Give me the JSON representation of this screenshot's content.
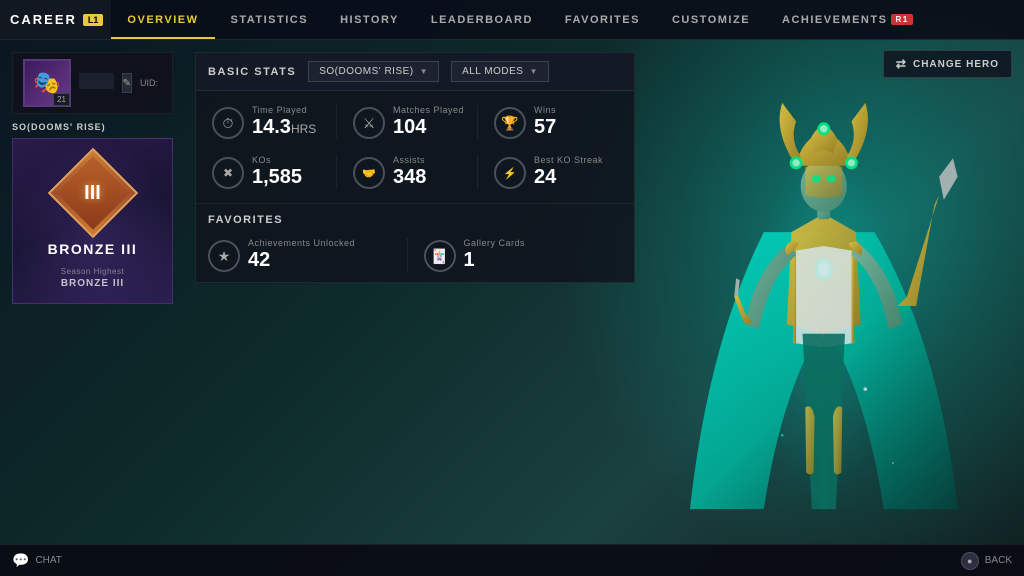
{
  "nav": {
    "career_label": "CAREER",
    "l1_badge": "L1",
    "r1_badge": "R1",
    "tabs": [
      {
        "id": "overview",
        "label": "OVERVIEW",
        "active": true
      },
      {
        "id": "statistics",
        "label": "STATISTICS",
        "active": false
      },
      {
        "id": "history",
        "label": "HISTORY",
        "active": false
      },
      {
        "id": "leaderboard",
        "label": "LEADERBOARD",
        "active": false
      },
      {
        "id": "favorites",
        "label": "FAVORITES",
        "active": false
      },
      {
        "id": "customize",
        "label": "CUSTOMIZE",
        "active": false
      },
      {
        "id": "achievements",
        "label": "ACHIEVEMENTS",
        "active": false,
        "badge": "R1"
      }
    ]
  },
  "profile": {
    "level": "21",
    "name": "",
    "uid_label": "UID:",
    "uid_value": ""
  },
  "left_panel": {
    "section_label": "SO(DOOMS' RISE)",
    "rank_name": "BRONZE III",
    "rank_numeral": "III",
    "season_highest_label": "Season Highest",
    "season_highest_value": "BRONZE III"
  },
  "basic_stats": {
    "header": "BASIC STATS",
    "dropdown1": "SO(DOOMS' RISE)",
    "dropdown2": "ALL MODES",
    "stats": [
      {
        "label": "Time Played",
        "value": "14.3",
        "unit": "HRS",
        "icon": "⏱"
      },
      {
        "label": "Matches Played",
        "value": "104",
        "unit": "",
        "icon": "⚔"
      },
      {
        "label": "Wins",
        "value": "57",
        "unit": "",
        "icon": "🏆"
      }
    ],
    "stats2": [
      {
        "label": "KOs",
        "value": "1,585",
        "unit": "",
        "icon": "✕"
      },
      {
        "label": "Assists",
        "value": "348",
        "unit": "",
        "icon": "🤝"
      },
      {
        "label": "Best KO Streak",
        "value": "24",
        "unit": "",
        "icon": "⚡"
      }
    ]
  },
  "favorites": {
    "header": "FAVORITES",
    "items": [
      {
        "label": "Achievements Unlocked",
        "value": "42",
        "icon": "★"
      },
      {
        "label": "Gallery Cards",
        "value": "1",
        "icon": "🃏"
      }
    ]
  },
  "buttons": {
    "change_hero": "CHANGE HERO",
    "chat": "CHAT",
    "back": "BACK"
  }
}
